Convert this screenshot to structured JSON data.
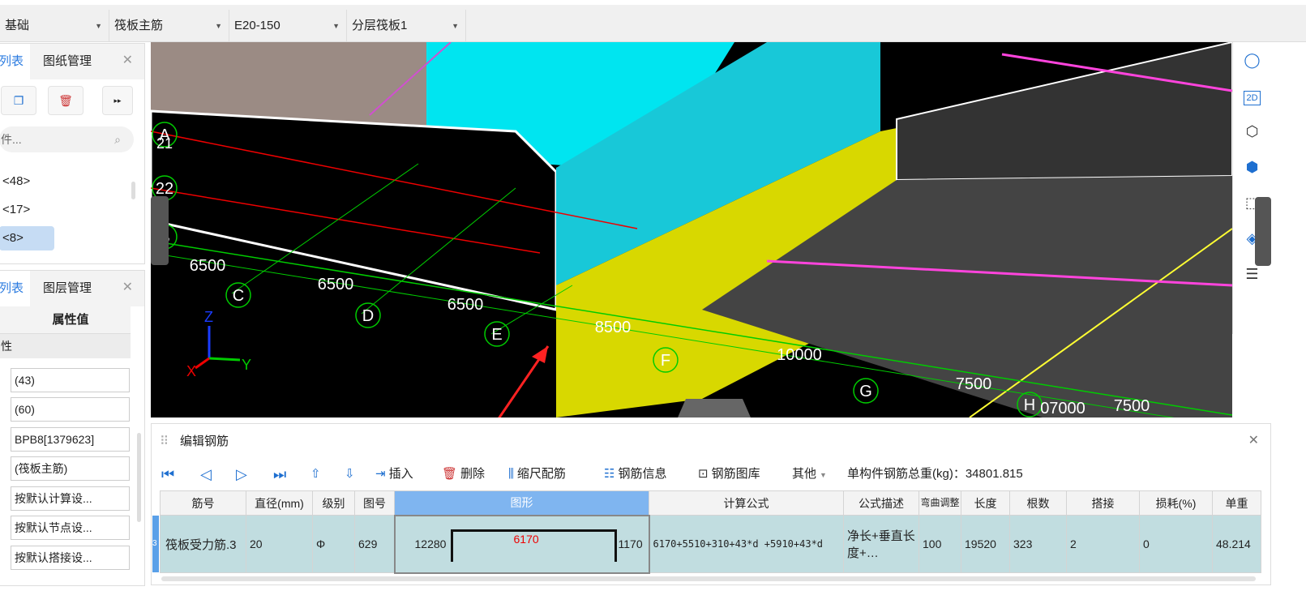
{
  "toolbar": {
    "dropdowns": [
      "基础",
      "筏板主筋",
      "E20-150",
      "分层筏板1"
    ]
  },
  "left_top": {
    "tabs": [
      "列表",
      "图纸管理"
    ],
    "search_placeholder": "件...",
    "tree": [
      "<48>",
      "<17>",
      "<8>"
    ]
  },
  "left_bottom": {
    "tabs": [
      "列表",
      "图层管理"
    ],
    "header": "属性值",
    "group": "性",
    "values": [
      "(43)",
      "(60)",
      "BPB8[1379623]",
      "(筏板主筋)",
      "按默认计算设...",
      "按默认节点设...",
      "按默认搭接设..."
    ]
  },
  "viewport": {
    "axes_labels": [
      "A",
      "21",
      "22",
      "B",
      "C",
      "D",
      "E",
      "F",
      "G",
      "H"
    ],
    "spans": [
      "6500",
      "6500",
      "6500",
      "8500",
      "10000",
      "7500",
      "07000",
      "7500"
    ],
    "axis": {
      "x": "X",
      "y": "Y",
      "z": "Z"
    }
  },
  "right_tools": [
    "orbit-icon",
    "2D",
    "cube-icon",
    "cube-blue-icon",
    "select-box-icon",
    "select-3d-icon",
    "view-eye-icon"
  ],
  "rebar_panel": {
    "title": "编辑钢筋",
    "actions": {
      "insert": "插入",
      "delete": "删除",
      "scale": "缩尺配筋",
      "info": "钢筋信息",
      "library": "钢筋图库",
      "other": "其他"
    },
    "total_weight_label": "单构件钢筋总重(kg)：34801.815",
    "columns": [
      "筋号",
      "直径(mm)",
      "级别",
      "图号",
      "图形",
      "计算公式",
      "公式描述",
      "弯曲调整",
      "长度",
      "根数",
      "搭接",
      "损耗(%)",
      "单重"
    ],
    "row": {
      "index": "3",
      "name": "筏板受力筋.3",
      "diameter": "20",
      "grade": "Φ",
      "shape_no": "629",
      "shape_left": "12280",
      "shape_mid": "6170",
      "shape_right": "1170",
      "formula": "6170+5510+310+43*d +5910+43*d",
      "desc": "净长+垂直长度+…",
      "bend": "100",
      "length": "19520",
      "count": "323",
      "lap": "2",
      "loss": "0",
      "unit_weight": "48.214"
    }
  }
}
